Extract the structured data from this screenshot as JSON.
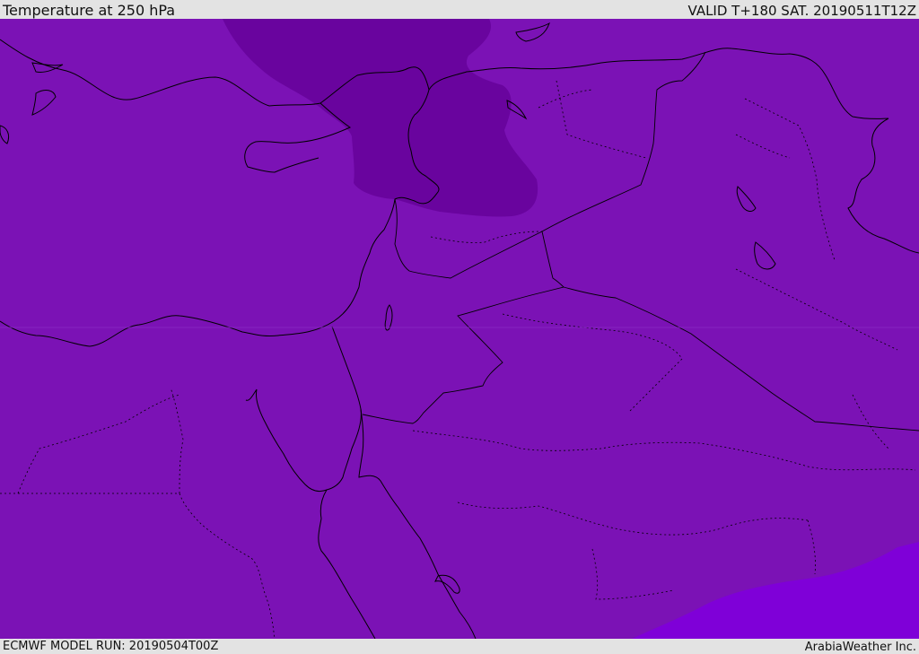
{
  "header": {
    "title": "Temperature at 250 hPa",
    "valid": "VALID T+180 SAT. 20190511T12Z"
  },
  "footer": {
    "model_run": "ECMWF MODEL RUN: 20190504T00Z",
    "credit": "ArabiaWeather Inc."
  },
  "map": {
    "variable": "Temperature",
    "level": "250 hPa",
    "colors": {
      "base_fill": "#7b12b5",
      "cold_area": "#69049e",
      "warm_area": "#7f00d8",
      "border_line": "#000000"
    }
  }
}
